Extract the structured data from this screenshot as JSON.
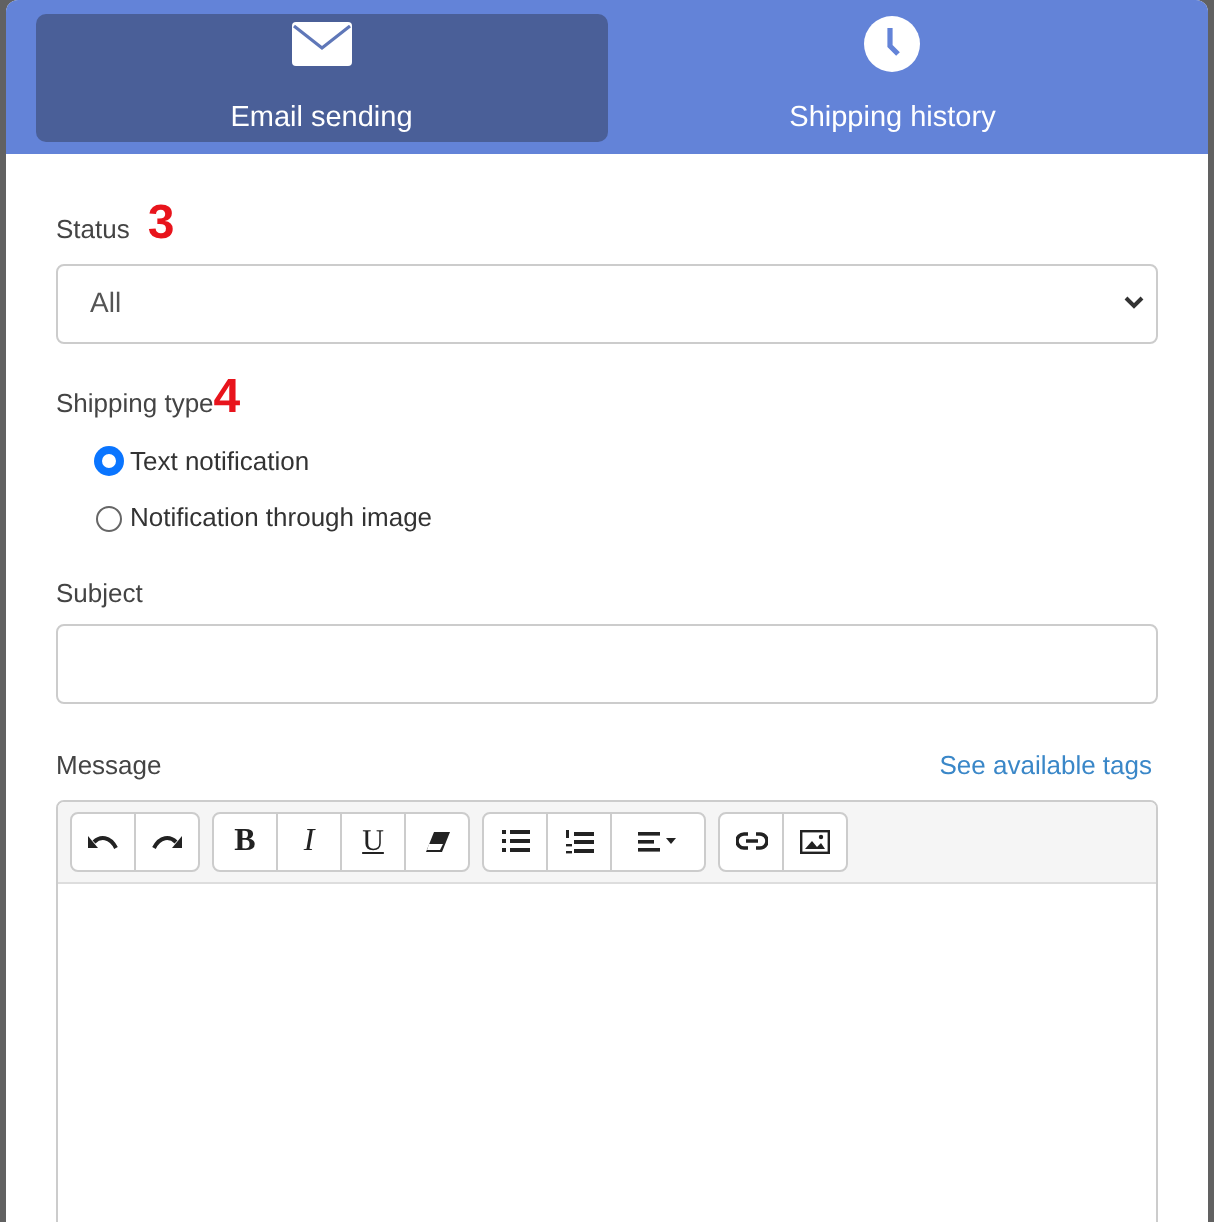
{
  "tabs": [
    {
      "label": "Email sending",
      "kind": "envelope",
      "selected": true
    },
    {
      "label": "Shipping history",
      "kind": "clock",
      "selected": false
    }
  ],
  "status": {
    "label": "Status",
    "annotation": "3",
    "value": "All"
  },
  "shipping_type": {
    "label": "Shipping type",
    "annotation": "4",
    "options": [
      {
        "label": "Text notification",
        "selected": true
      },
      {
        "label": "Notification through image",
        "selected": false
      }
    ]
  },
  "subject": {
    "label": "Subject"
  },
  "message": {
    "label": "Message",
    "link": "See available tags",
    "toolbar": [
      [
        {
          "kind": "undo"
        },
        {
          "kind": "redo"
        }
      ],
      [
        {
          "kind": "bold",
          "label": "B"
        },
        {
          "kind": "italic",
          "label": "I"
        },
        {
          "kind": "underline",
          "label": "U"
        },
        {
          "kind": "eraser"
        }
      ],
      [
        {
          "kind": "bullets"
        },
        {
          "kind": "numbers"
        },
        {
          "kind": "align"
        }
      ],
      [
        {
          "kind": "link"
        },
        {
          "kind": "image"
        }
      ]
    ]
  }
}
